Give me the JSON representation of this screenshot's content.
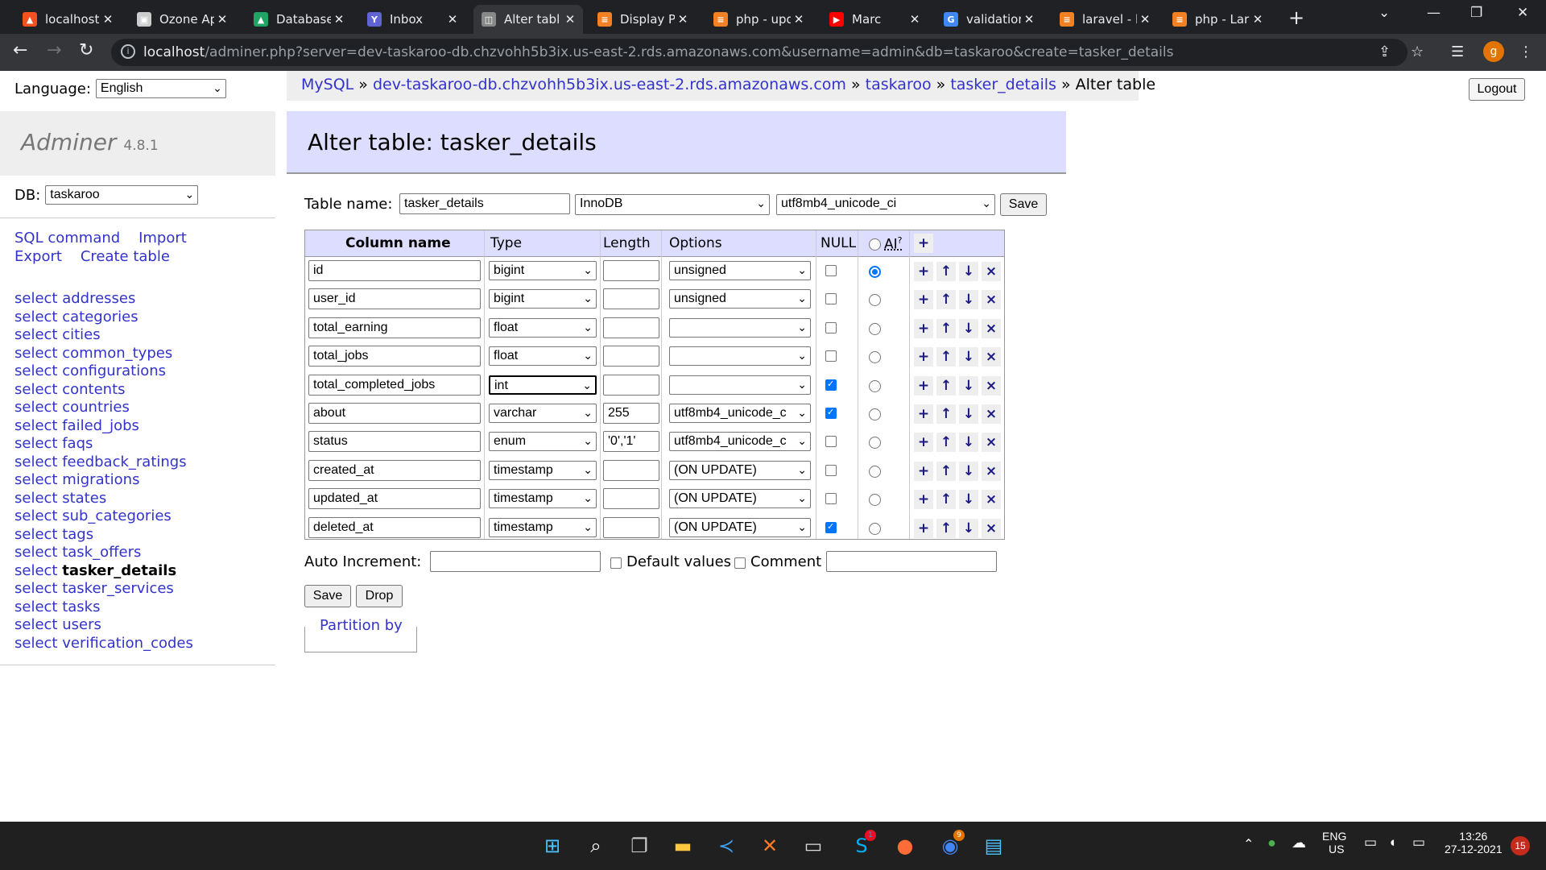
{
  "tabs": [
    {
      "title": "localhost",
      "color": "#f4511e",
      "glyph": "▲"
    },
    {
      "title": "Ozone Ap",
      "color": "#cccccc",
      "glyph": "▣"
    },
    {
      "title": "Database",
      "color": "#1fa463",
      "glyph": "▲"
    },
    {
      "title": "Inbox",
      "color": "#5f63d4",
      "glyph": "Y"
    },
    {
      "title": "Alter tabl",
      "color": "#888888",
      "glyph": "◫"
    },
    {
      "title": "Display P",
      "color": "#f48024",
      "glyph": "≡"
    },
    {
      "title": "php - upd",
      "color": "#f48024",
      "glyph": "≡"
    },
    {
      "title": "Marc",
      "color": "#ff0000",
      "glyph": "▶"
    },
    {
      "title": "validation",
      "color": "#4285f4",
      "glyph": "G"
    },
    {
      "title": "laravel - l",
      "color": "#f48024",
      "glyph": "≡"
    },
    {
      "title": "php - Lar",
      "color": "#f48024",
      "glyph": "≡"
    }
  ],
  "url": {
    "host": "localhost",
    "rest": "/adminer.php?server=dev-taskaroo-db.chzvohh5b3ix.us-east-2.rds.amazonaws.com&username=admin&db=taskaroo&create=tasker_details"
  },
  "profile_initial": "g",
  "sidebar": {
    "language_label": "Language:",
    "language_value": "English",
    "app_name": "Adminer",
    "version": "4.8.1",
    "db_label": "DB:",
    "db_value": "taskaroo",
    "links": {
      "sql": "SQL command",
      "import": "Import",
      "export": "Export",
      "create": "Create table"
    },
    "tables": [
      {
        "select": "select",
        "name": "addresses"
      },
      {
        "select": "select",
        "name": "categories"
      },
      {
        "select": "select",
        "name": "cities"
      },
      {
        "select": "select",
        "name": "common_types"
      },
      {
        "select": "select",
        "name": "configurations"
      },
      {
        "select": "select",
        "name": "contents"
      },
      {
        "select": "select",
        "name": "countries"
      },
      {
        "select": "select",
        "name": "failed_jobs"
      },
      {
        "select": "select",
        "name": "faqs"
      },
      {
        "select": "select",
        "name": "feedback_ratings"
      },
      {
        "select": "select",
        "name": "migrations"
      },
      {
        "select": "select",
        "name": "states"
      },
      {
        "select": "select",
        "name": "sub_categories"
      },
      {
        "select": "select",
        "name": "tags"
      },
      {
        "select": "select",
        "name": "task_offers"
      },
      {
        "select": "select",
        "name": "tasker_details",
        "active": true
      },
      {
        "select": "select",
        "name": "tasker_services"
      },
      {
        "select": "select",
        "name": "tasks"
      },
      {
        "select": "select",
        "name": "users"
      },
      {
        "select": "select",
        "name": "verification_codes"
      }
    ]
  },
  "breadcrumb": {
    "mysql": "MySQL",
    "sep": "»",
    "server": "dev-taskaroo-db.chzvohh5b3ix.us-east-2.rds.amazonaws.com",
    "db": "taskaroo",
    "table": "tasker_details",
    "current": "Alter table"
  },
  "logout": "Logout",
  "heading": "Alter table: tasker_details",
  "form": {
    "table_name_label": "Table name:",
    "table_name": "tasker_details",
    "engine": "InnoDB",
    "collation": "utf8mb4_unicode_ci",
    "save": "Save",
    "headers": {
      "column": "Column name",
      "type": "Type",
      "length": "Length",
      "options": "Options",
      "null": "NULL",
      "ai": "AI",
      "ai_sup": "?",
      "add": "+"
    },
    "columns": [
      {
        "name": "id",
        "type": "bigint",
        "length": "",
        "options": "unsigned",
        "null": false,
        "ai": true
      },
      {
        "name": "user_id",
        "type": "bigint",
        "length": "",
        "options": "unsigned",
        "null": false,
        "ai": false
      },
      {
        "name": "total_earning",
        "type": "float",
        "length": "",
        "options": "",
        "null": false,
        "ai": false
      },
      {
        "name": "total_jobs",
        "type": "float",
        "length": "",
        "options": "",
        "null": false,
        "ai": false
      },
      {
        "name": "total_completed_jobs",
        "type": "int",
        "length": "",
        "options": "",
        "null": true,
        "ai": false,
        "focused": true
      },
      {
        "name": "about",
        "type": "varchar",
        "length": "255",
        "options": "utf8mb4_unicode_c",
        "null": true,
        "ai": false
      },
      {
        "name": "status",
        "type": "enum",
        "length": "'0','1'",
        "options": "utf8mb4_unicode_c",
        "null": false,
        "ai": false
      },
      {
        "name": "created_at",
        "type": "timestamp",
        "length": "",
        "options": "(ON UPDATE)",
        "null": false,
        "ai": false
      },
      {
        "name": "updated_at",
        "type": "timestamp",
        "length": "",
        "options": "(ON UPDATE)",
        "null": false,
        "ai": false
      },
      {
        "name": "deleted_at",
        "type": "timestamp",
        "length": "",
        "options": "(ON UPDATE)",
        "null": true,
        "ai": false
      }
    ],
    "row_buttons": {
      "add": "+",
      "up": "↑",
      "down": "↓",
      "remove": "×"
    },
    "auto_increment_label": "Auto Increment:",
    "auto_increment_value": "",
    "default_values_label": "Default values",
    "comment_label": "Comment",
    "comment_value": "",
    "save_btn": "Save",
    "drop_btn": "Drop",
    "partition_label": "Partition by"
  },
  "taskbar": {
    "lang": "ENG",
    "region": "US",
    "time": "13:26",
    "date": "27-12-2021",
    "notif_count": "15",
    "skype_badge": "1",
    "chrome_badge": "9"
  }
}
